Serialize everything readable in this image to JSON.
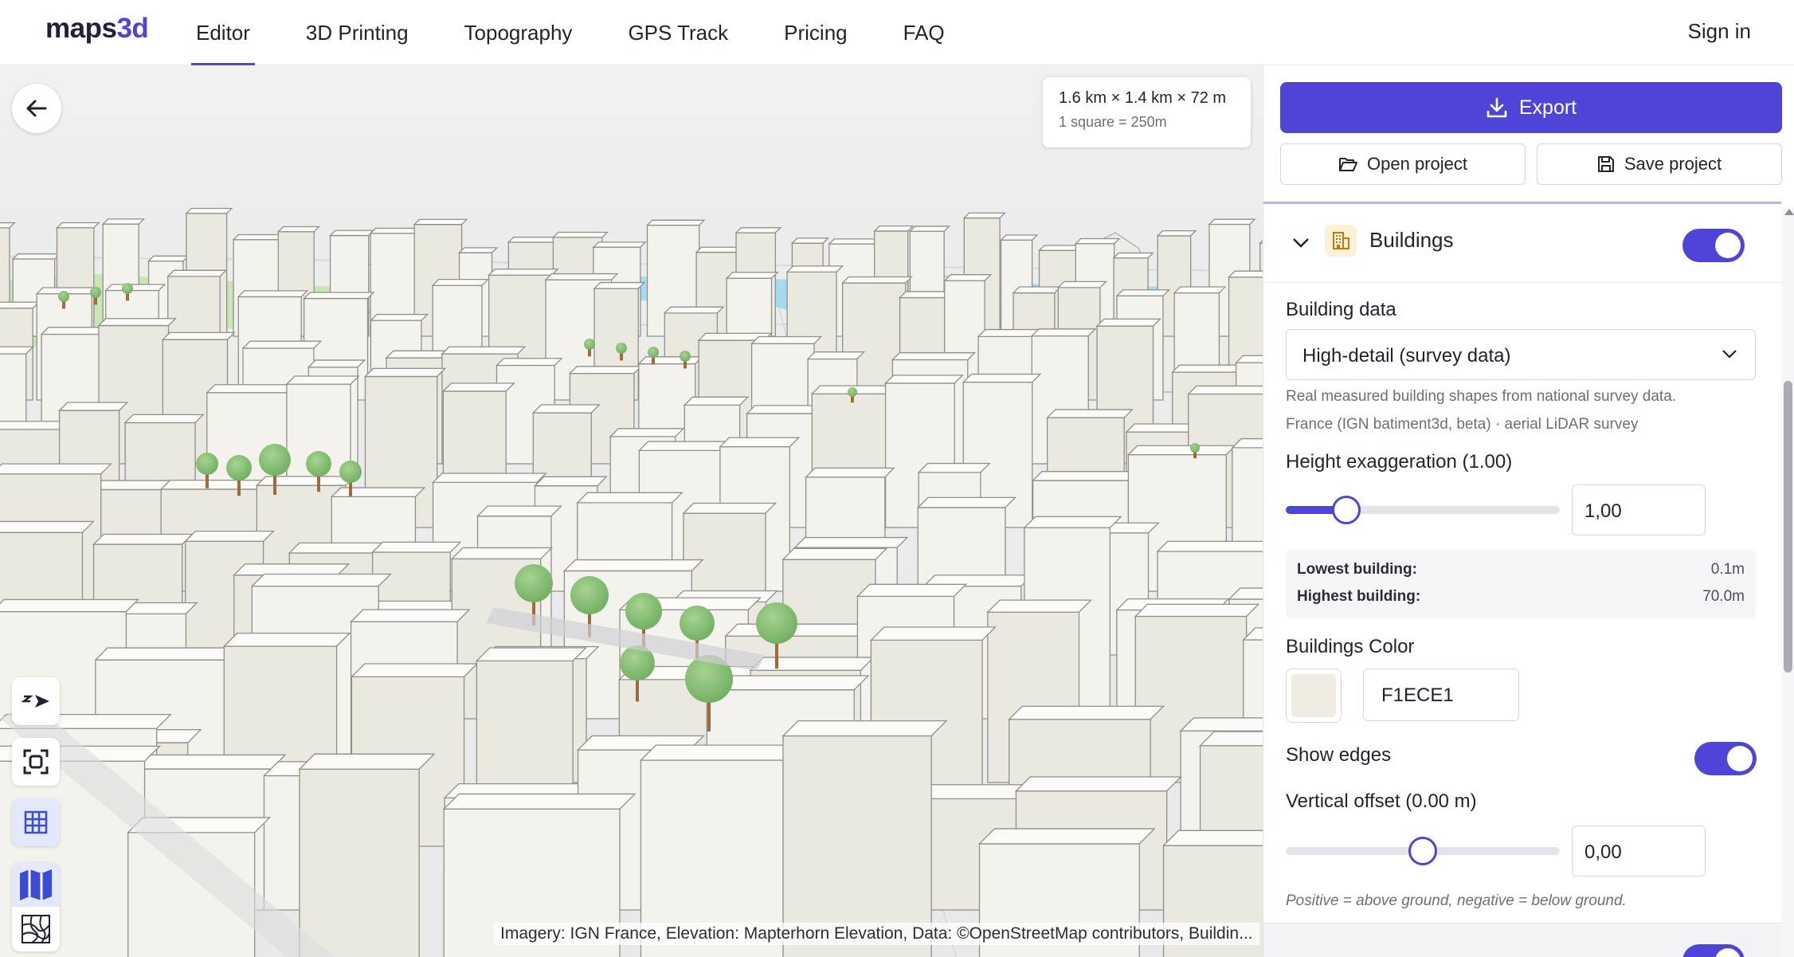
{
  "app": {
    "logo_text": "maps",
    "logo_accent": "3d",
    "brand_color": "#4e45d8"
  },
  "nav": {
    "items": [
      {
        "label": "Editor",
        "active": true
      },
      {
        "label": "3D Printing"
      },
      {
        "label": "Topography"
      },
      {
        "label": "GPS Track"
      },
      {
        "label": "Pricing"
      },
      {
        "label": "FAQ"
      }
    ],
    "signin_label": "Sign in"
  },
  "map": {
    "dimensions": "1.6 km × 1.4 km × 72 m",
    "grid_scale": "1 square = 250m",
    "attribution": "Imagery: IGN France, Elevation: Mapterhorn Elevation, Data: ©OpenStreetMap contributors, Buildin...",
    "tools": [
      "back-arrow-icon",
      "compass-icon",
      "frame-icon",
      "grid-icon",
      "map-icon",
      "texture-icon"
    ]
  },
  "panel": {
    "export_label": "Export",
    "open_label": "Open project",
    "save_label": "Save project",
    "buildings": {
      "title": "Buildings",
      "enabled": true,
      "building_data_label": "Building data",
      "building_data_value": "High-detail (survey data)",
      "help_line1": "Real measured building shapes from national survey data.",
      "help_line2": "France (IGN batiment3d, beta) · aerial LiDAR survey",
      "height_label": "Height exaggeration (1.00)",
      "height_value": "1,00",
      "height_slider_fraction": 0.22,
      "lowest_label": "Lowest building:",
      "lowest_value": "0.1m",
      "highest_label": "Highest building:",
      "highest_value": "70.0m",
      "color_label": "Buildings Color",
      "color_hex": "F1ECE1",
      "color_swatch": "#f1ece1",
      "edges_label": "Show edges",
      "edges_enabled": true,
      "offset_label": "Vertical offset (0.00 m)",
      "offset_value": "0,00",
      "offset_slider_fraction": 0.5,
      "offset_help": "Positive = above ground, negative = below ground."
    }
  }
}
